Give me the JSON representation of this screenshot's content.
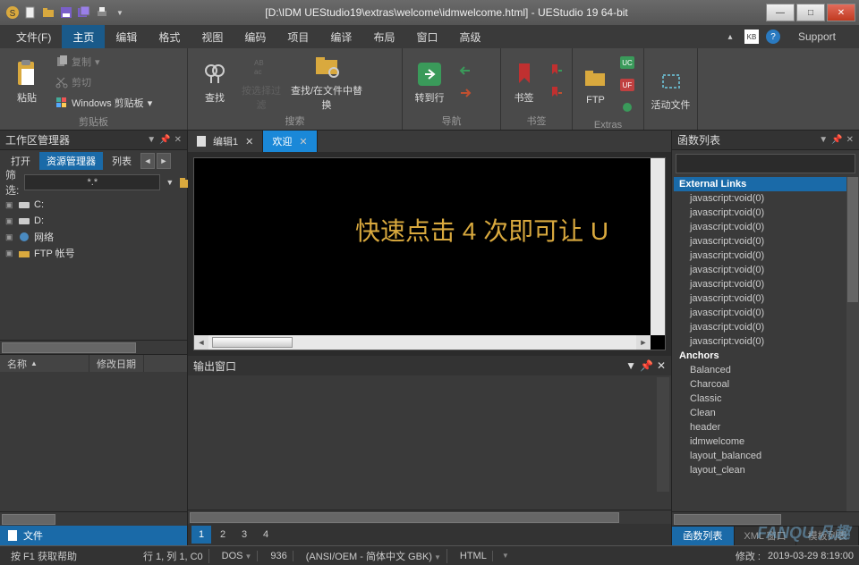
{
  "title": "[D:\\IDM UEStudio19\\extras\\welcome\\idmwelcome.html] - UEStudio 19 64-bit",
  "menu": {
    "items": [
      "文件(F)",
      "主页",
      "编辑",
      "格式",
      "视图",
      "编码",
      "项目",
      "编译",
      "布局",
      "窗口",
      "高级"
    ],
    "active": 1,
    "support": "Support"
  },
  "ribbon": {
    "clipboard": {
      "label": "剪贴板",
      "paste": "粘贴",
      "copy": "复制",
      "cut": "剪切",
      "winclip": "Windows 剪贴板"
    },
    "search": {
      "label": "搜索",
      "find": "查找",
      "filter": "按选择过滤",
      "replace": "查找/在文件中替换"
    },
    "nav": {
      "label": "导航",
      "goto": "转到行"
    },
    "bookmark": {
      "label": "书签",
      "bm": "书签"
    },
    "extras": {
      "label": "Extras",
      "ftp": "FTP"
    },
    "active": {
      "label": "活动文件"
    }
  },
  "workspace": {
    "title": "工作区管理器",
    "tabs": {
      "open": "打开",
      "explorer": "资源管理器",
      "list": "列表"
    },
    "filter": {
      "label": "筛选:",
      "value": "*.*"
    },
    "tree": [
      {
        "label": "C:"
      },
      {
        "label": "D:"
      },
      {
        "label": "网络"
      },
      {
        "label": "FTP 帐号"
      }
    ],
    "cols": {
      "name": "名称",
      "date": "修改日期"
    },
    "filetab": "文件"
  },
  "tabs": [
    {
      "label": "编辑1",
      "active": false
    },
    {
      "label": "欢迎",
      "active": true
    }
  ],
  "editor": {
    "text": "快速点击 4 次即可让 U"
  },
  "output": {
    "title": "输出窗口",
    "pages": [
      "1",
      "2",
      "3",
      "4"
    ],
    "active": 0
  },
  "funcs": {
    "title": "函数列表",
    "h1": "External Links",
    "links": [
      "javascript:void(0)",
      "javascript:void(0)",
      "javascript:void(0)",
      "javascript:void(0)",
      "javascript:void(0)",
      "javascript:void(0)",
      "javascript:void(0)",
      "javascript:void(0)",
      "javascript:void(0)",
      "javascript:void(0)",
      "javascript:void(0)"
    ],
    "h2": "Anchors",
    "anchors": [
      "Balanced",
      "Charcoal",
      "Classic",
      "Clean",
      "header",
      "idmwelcome",
      "layout_balanced",
      "layout_clean"
    ],
    "btabs": [
      "函数列表",
      "XML 窗口",
      "模板列表"
    ],
    "bactive": 0
  },
  "status": {
    "help": "按 F1 获取帮助",
    "pos": "行 1, 列 1, C0",
    "dos": "DOS",
    "cp": "936",
    "enc": "(ANSI/OEM - 简体中文 GBK)",
    "lang": "HTML",
    "mod": "修改 :",
    "time": "2019-03-29 8:19:00"
  },
  "watermark": "FANQU 凡趣"
}
